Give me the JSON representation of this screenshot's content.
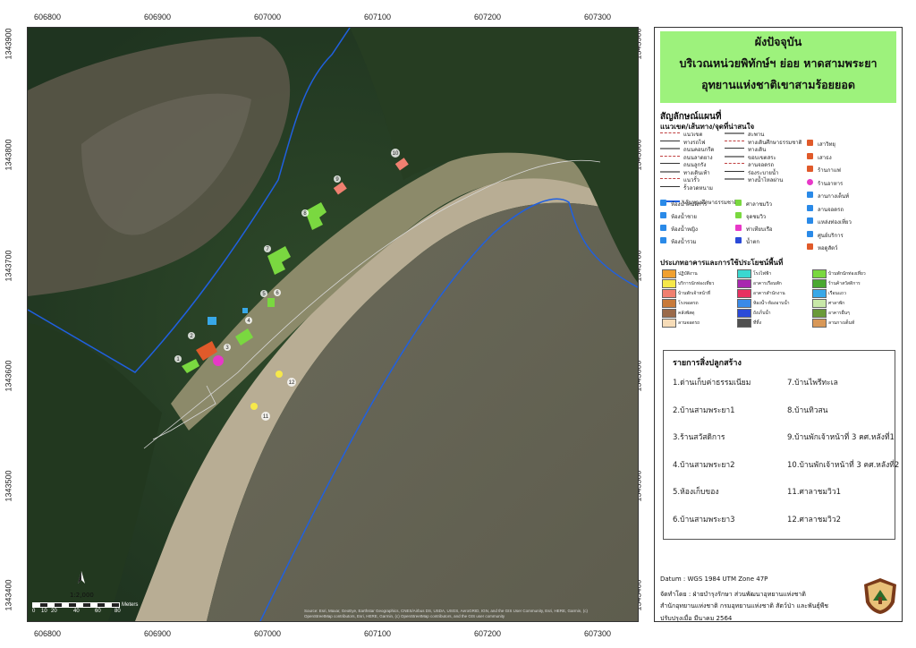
{
  "coords": {
    "top": [
      "606800",
      "606900",
      "607000",
      "607100",
      "607200",
      "607300"
    ],
    "left": [
      "1343900",
      "1343800",
      "1343700",
      "1343600",
      "1343500",
      "1343400"
    ],
    "bottom": [
      "606800",
      "606900",
      "607000",
      "607100",
      "607200",
      "607300"
    ],
    "right": [
      "1343900",
      "1343800",
      "1343700",
      "1343600",
      "1343500",
      "1343400"
    ]
  },
  "title": {
    "line1": "ผังปัจจุบัน",
    "line2": "บริเวณหน่วยพิทักษ์ฯ ย่อย หาดสามพระยา",
    "line3": "อุทยานแห่งชาติเขาสามร้อยยอด"
  },
  "legend": {
    "heading": "สัญลักษณ์แผนที่",
    "subheading": "แนวเขต/เส้นทาง/จุดที่น่าสนใจ",
    "line_items": [
      "แนวเขต",
      "ทางรถไฟ",
      "ถนนคอนกรีต",
      "ถนนลาดยาง",
      "ถนนลูกรัง",
      "ทางเดินเท้า",
      "แนวรั้ว",
      "รั้วลวดหนาม",
      "สะพาน",
      "ทางเดินศึกษาธรรมชาติ",
      "ทางเดิน",
      "ขอบเขตสระ",
      "ลานจอดรถ",
      "ร่องระบายน้ำ",
      "ทางน้ำไหลผ่าน"
    ],
    "boundary_label": "เส้นทางศึกษาธรรมชาติ",
    "poi_items": [
      "ห้องน้ำคนพิการ",
      "ห้องน้ำชาย",
      "ห้องน้ำหญิง",
      "ห้องน้ำรวม",
      "ศาลาชมวิว",
      "จุดชมวิว",
      "ท่าเทียบเรือ",
      "น้ำตก",
      "เสาวิทยุ",
      "เสาธง",
      "ร้านกาแฟ",
      "ร้านอาหาร",
      "ลานกางเต็นท์",
      "ลานจอดรถ",
      "แหล่งท่องเที่ยว",
      "ศูนย์บริการ",
      "หอดูสัตว์"
    ],
    "landuse_heading": "ประเภทอาคารและการใช้ประโยชน์พื้นที่",
    "landuse_items": [
      {
        "label": "ปฏิบัติงาน",
        "color": "#f0a030"
      },
      {
        "label": "บริการนักท่องเที่ยว",
        "color": "#f6e84a"
      },
      {
        "label": "บ้านพักเจ้าหน้าที่",
        "color": "#f08070"
      },
      {
        "label": "โรงจอดรถ",
        "color": "#c87a3a"
      },
      {
        "label": "คลังพัสดุ",
        "color": "#9a6a4a"
      },
      {
        "label": "ลานจอดรถ",
        "color": "#f6dcb8"
      },
      {
        "label": "โรงไฟฟ้า",
        "color": "#3ad8d0"
      },
      {
        "label": "อาคารเรือนพัก",
        "color": "#a828b0"
      },
      {
        "label": "อาคารสำนักงาน",
        "color": "#e83060"
      },
      {
        "label": "ห้องน้ำ-ห้องอาบน้ำ",
        "color": "#3a8ae8"
      },
      {
        "label": "ถังเก็บน้ำ",
        "color": "#2a4ad8"
      },
      {
        "label": "ที่ทิ้ง",
        "color": "#505050"
      },
      {
        "label": "บ้านพักนักท่องเที่ยว",
        "color": "#7ad840"
      },
      {
        "label": "ร้านค้าสวัสดิการ",
        "color": "#4aa830"
      },
      {
        "label": "เรือนแถว",
        "color": "#38a8e8"
      },
      {
        "label": "ศาลาพัก",
        "color": "#c8e8a8"
      },
      {
        "label": "อาคารอื่นๆ",
        "color": "#6a9a38"
      },
      {
        "label": "ลานกางเต็นท์",
        "color": "#d89858"
      }
    ]
  },
  "buildings": {
    "heading": "รายการสิ่งปลูกสร้าง",
    "items": [
      "1.ด่านเก็บค่าธรรมเนียม",
      "2.บ้านสามพระยา1",
      "3.ร้านสวัสดิการ",
      "4.บ้านสามพระยา2",
      "5.ห้องเก็บของ",
      "6.บ้านสามพระยา3",
      "7.บ้านไพรีทะเล",
      "8.บ้านทิวสน",
      "9.บ้านพักเจ้าหน้าที่ 3 คศ.หลังที่1",
      "10.บ้านพักเจ้าหน้าที่ 3 คศ.หลังที่2",
      "11.ศาลาชมวิว1",
      "12.ศาลาชมวิว2"
    ]
  },
  "info": {
    "datum": "Datum  :  WGS 1984 UTM Zone 47P",
    "made_by": "จัดทำโดย  :  ฝ่ายบำรุงรักษา ส่วนพัฒนาอุทยานแห่งชาติ",
    "office": "สำนักอุทยานแห่งชาติ  กรมอุทยานแห่งชาติ สัตว์ป่า และพันธุ์พืช",
    "updated": "ปรับปรุงเมื่อ มีนาคม 2564"
  },
  "scale": {
    "ratio": "1:2,000",
    "ticks": [
      "0",
      "10",
      "20",
      "40",
      "60",
      "80"
    ],
    "unit": "Meters"
  },
  "attribution": {
    "line1": "Source: Esri, Maxar, GeoEye, Earthstar Geographics, CNES/Airbus DS, USDA, USGS, AeroGRID, IGN, and the GIS User Community, Esri, HERE, Garmin, (c)",
    "line2": "OpenStreetMap contributors, Esri, HERE, Garmin, (c) OpenStreetMap contributors, and the GIS user community"
  },
  "map_labels": [
    "1",
    "2",
    "3",
    "4",
    "5",
    "6",
    "7",
    "8",
    "9",
    "10",
    "11",
    "12"
  ]
}
